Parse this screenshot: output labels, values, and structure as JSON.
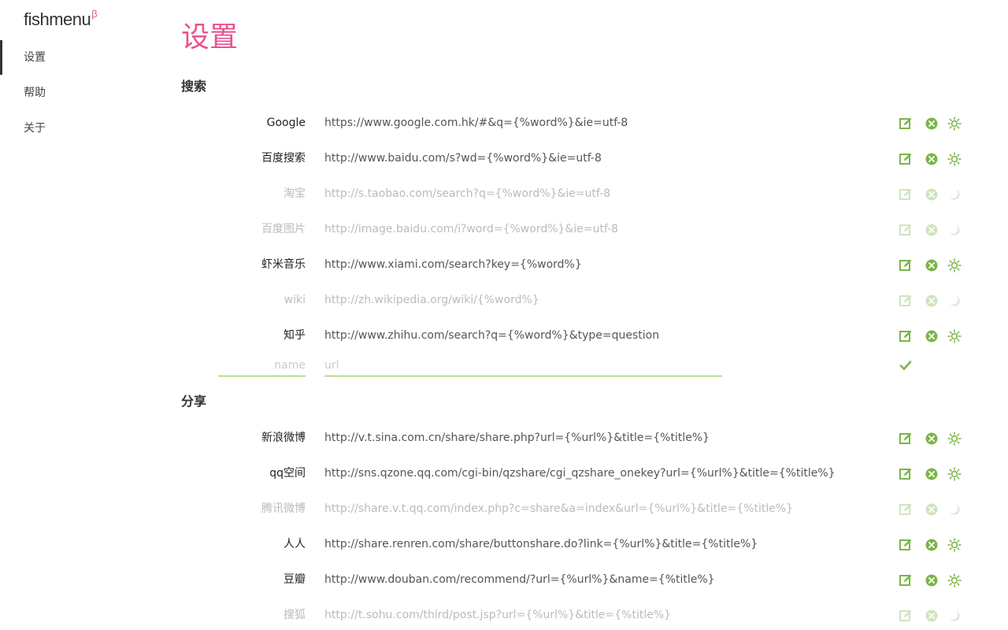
{
  "brand": {
    "name": "fishmenu",
    "sup": "β"
  },
  "nav": [
    {
      "label": "设置",
      "active": true
    },
    {
      "label": "帮助",
      "active": false
    },
    {
      "label": "关于",
      "active": false
    }
  ],
  "page_title": "设置",
  "sections": {
    "search": {
      "title": "搜索",
      "rows": [
        {
          "name": "Google",
          "url": "https://www.google.com.hk/#&q={%word%}&ie=utf-8",
          "enabled": true
        },
        {
          "name": "百度搜索",
          "url": "http://www.baidu.com/s?wd={%word%}&ie=utf-8",
          "enabled": true
        },
        {
          "name": "淘宝",
          "url": "http://s.taobao.com/search?q={%word%}&ie=utf-8",
          "enabled": false
        },
        {
          "name": "百度图片",
          "url": "http://image.baidu.com/i?word={%word%}&ie=utf-8",
          "enabled": false
        },
        {
          "name": "虾米音乐",
          "url": "http://www.xiami.com/search?key={%word%}",
          "enabled": true
        },
        {
          "name": "wiki",
          "url": "http://zh.wikipedia.org/wiki/{%word%}",
          "enabled": false
        },
        {
          "name": "知乎",
          "url": "http://www.zhihu.com/search?q={%word%}&type=question",
          "enabled": true
        }
      ],
      "add": {
        "name_placeholder": "name",
        "url_placeholder": "url"
      }
    },
    "share": {
      "title": "分享",
      "rows": [
        {
          "name": "新浪微博",
          "url": "http://v.t.sina.com.cn/share/share.php?url={%url%}&title={%title%}",
          "enabled": true
        },
        {
          "name": "qq空间",
          "url": "http://sns.qzone.qq.com/cgi-bin/qzshare/cgi_qzshare_onekey?url={%url%}&title={%title%}",
          "enabled": true
        },
        {
          "name": "腾讯微博",
          "url": "http://share.v.t.qq.com/index.php?c=share&a=index&url={%url%}&title={%title%}",
          "enabled": false
        },
        {
          "name": "人人",
          "url": "http://share.renren.com/share/buttonshare.do?link={%url%}&title={%title%}",
          "enabled": true
        },
        {
          "name": "豆瓣",
          "url": "http://www.douban.com/recommend/?url={%url%}&name={%title%}",
          "enabled": true
        },
        {
          "name": "搜狐",
          "url": "http://t.sohu.com/third/post.jsp?url={%url%}&title={%title%}",
          "enabled": false
        }
      ]
    }
  },
  "icons": {
    "edit": "edit-icon",
    "delete": "delete-icon",
    "enabled": "sun-icon",
    "disabled": "moon-icon",
    "confirm": "checkmark-icon"
  },
  "colors": {
    "accent": "#e8538f",
    "green": "#7ab648",
    "disabled_green": "#c5e0b0",
    "moon": "#e2e2e2"
  }
}
